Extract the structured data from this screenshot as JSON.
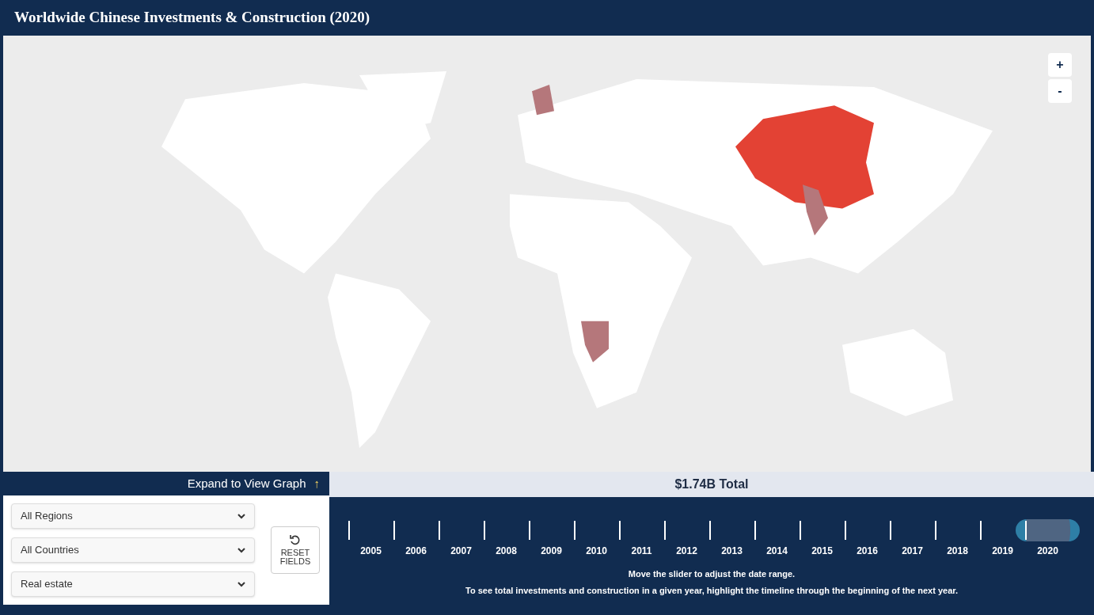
{
  "title": "Worldwide Chinese Investments & Construction (2020)",
  "zoom_controls": [
    "+",
    "-"
  ],
  "expand_link": {
    "label": "Expand to View Graph",
    "arrow": "↑"
  },
  "filters": [
    {
      "value": "All Regions"
    },
    {
      "value": "All Countries"
    },
    {
      "value": "Real estate"
    }
  ],
  "reset_button": [
    "RESET",
    "FIELDS"
  ],
  "total": "$1.74B Total",
  "years": [
    {
      "label": "2005",
      "selected": false
    },
    {
      "label": "2006",
      "selected": false
    },
    {
      "label": "2007",
      "selected": false
    },
    {
      "label": "2008",
      "selected": false
    },
    {
      "label": "2009",
      "selected": false
    },
    {
      "label": "2010",
      "selected": false
    },
    {
      "label": "2011",
      "selected": false
    },
    {
      "label": "2012",
      "selected": false
    },
    {
      "label": "2013",
      "selected": false
    },
    {
      "label": "2014",
      "selected": false
    },
    {
      "label": "2015",
      "selected": false
    },
    {
      "label": "2016",
      "selected": false
    },
    {
      "label": "2017",
      "selected": false
    },
    {
      "label": "2018",
      "selected": false
    },
    {
      "label": "2019",
      "selected": false
    },
    {
      "label": "2020",
      "selected": true
    }
  ],
  "instructions": [
    "Move the slider to adjust the date range.",
    "To see total investments and construction in a given year, highlight the timeline through the beginning of the next year."
  ]
}
